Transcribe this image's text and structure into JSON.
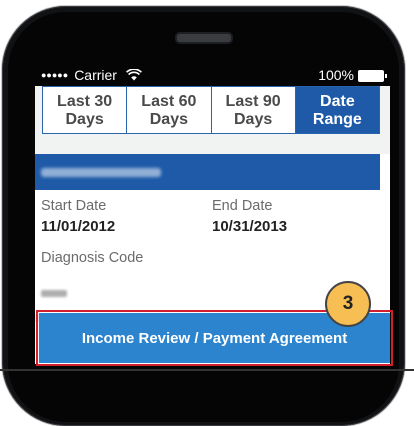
{
  "status_bar": {
    "signal": "●●●●●",
    "carrier": "Carrier",
    "battery_percent": "100%"
  },
  "date_tabs": [
    {
      "line1": "Last 30",
      "line2": "Days",
      "active": false
    },
    {
      "line1": "Last 60",
      "line2": "Days",
      "active": false
    },
    {
      "line1": "Last 90",
      "line2": "Days",
      "active": false
    },
    {
      "line1": "Date",
      "line2": "Range",
      "active": true
    }
  ],
  "record": {
    "start_date_label": "Start Date",
    "start_date_value": "11/01/2012",
    "end_date_label": "End Date",
    "end_date_value": "10/31/2013",
    "diagnosis_code_label": "Diagnosis Code"
  },
  "action_button": {
    "label": "Income Review / Payment Agreement"
  },
  "step_badge": {
    "number": "3"
  },
  "colors": {
    "brand_blue": "#1f5aa8",
    "button_blue": "#2c83ce",
    "highlight_red": "#d21f2b",
    "badge_orange": "#f6be53"
  }
}
